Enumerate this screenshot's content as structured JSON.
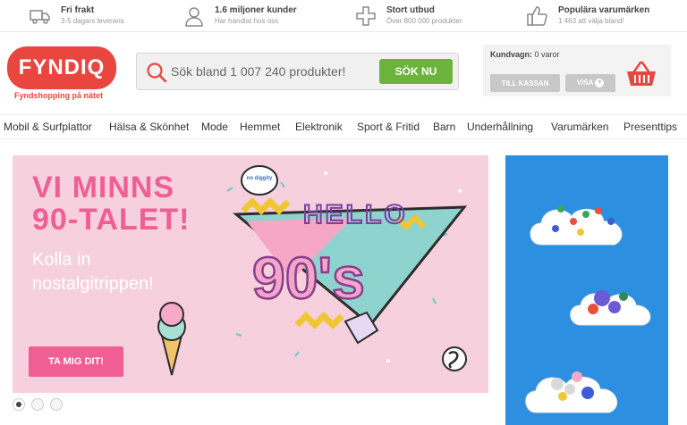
{
  "usps": [
    {
      "title": "Fri frakt",
      "sub": "3-5 dagars leverans",
      "icon": "truck-icon"
    },
    {
      "title": "1.6 miljoner kunder",
      "sub": "Har handlat hos oss",
      "icon": "user-icon"
    },
    {
      "title": "Stort utbud",
      "sub": "Över 800 000 produkter",
      "icon": "plus-icon"
    },
    {
      "title": "Populära varumärken",
      "sub": "1 463 att välja bland!",
      "icon": "thumbs-up-icon"
    }
  ],
  "logo": {
    "text": "FYNDIQ",
    "tagline": "Fyndshopping på nätet"
  },
  "search": {
    "placeholder": "Sök bland 1 007 240 produkter!",
    "button": "SÖK NU"
  },
  "cart": {
    "label": "Kundvagn:",
    "value": "0 varor",
    "checkout": "TILL KASSAN",
    "show": "VISA"
  },
  "nav": [
    "Mobil & Surfplattor",
    "Hälsa & Skönhet",
    "Mode",
    "Hemmet",
    "Elektronik",
    "Sport & Fritid",
    "Barn",
    "Underhållning",
    "Varumärken",
    "Presenttips"
  ],
  "hero": {
    "headline_1": "VI MINNS",
    "headline_2": "90-TALET!",
    "sub_1": "Kolla in",
    "sub_2": "nostalgitrippen!",
    "art_hello": "HELLO",
    "art_90s": "90's",
    "art_bubble": "no diggity",
    "cta": "TA MIG DIT!"
  },
  "colors": {
    "brand": "#e8463e",
    "search_button": "#6bb33b",
    "hero_bg": "#f7d0dd",
    "hero_pink": "#ee5f93",
    "side_bg": "#2d8fe0"
  }
}
